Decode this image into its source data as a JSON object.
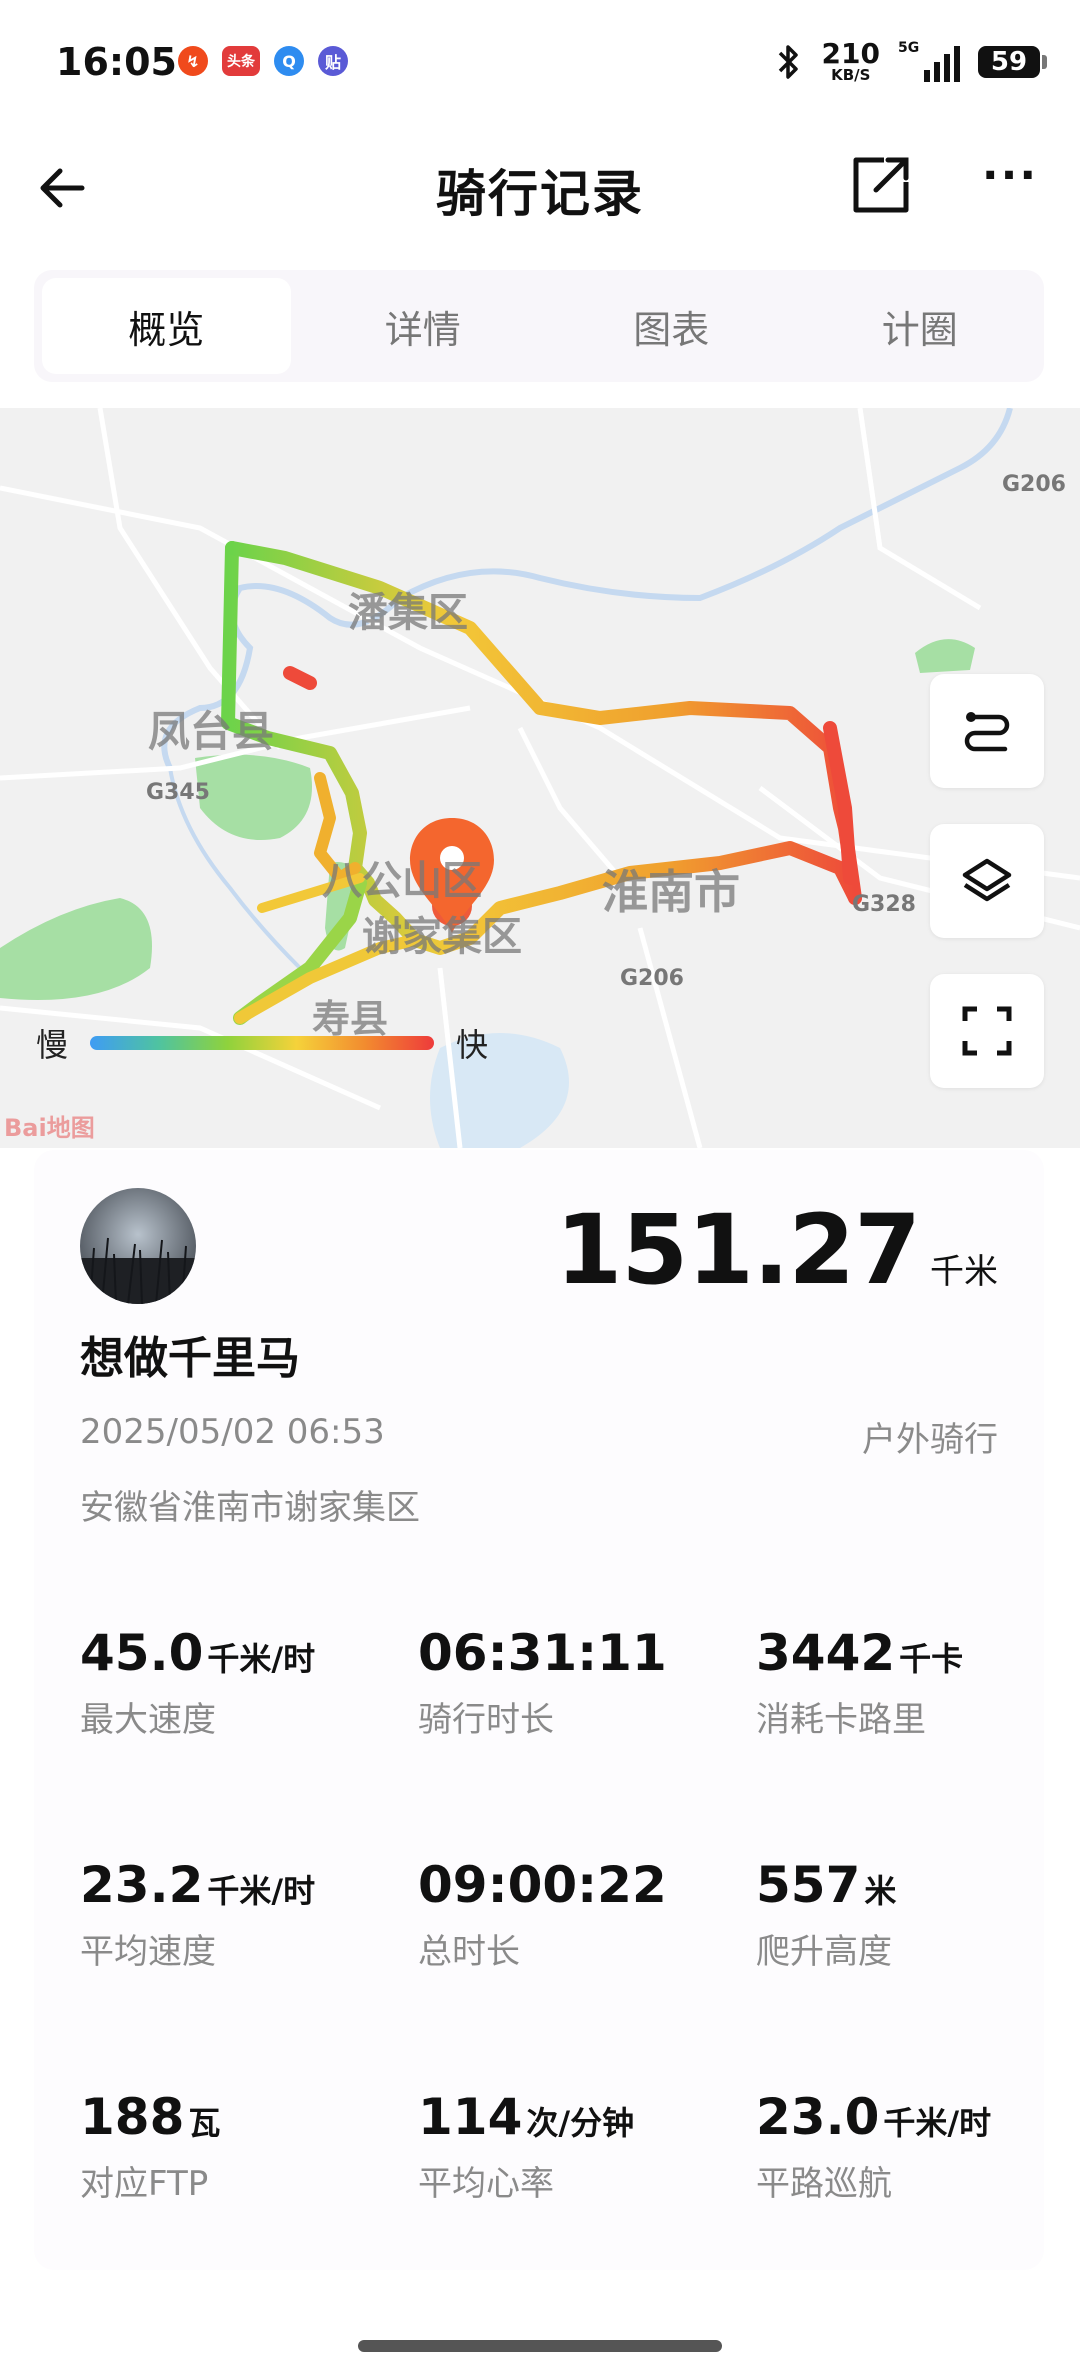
{
  "status_bar": {
    "time": "16:05",
    "app_icons": [
      {
        "name": "news-app-icon",
        "glyph": "↯",
        "color": "#f04a1c"
      },
      {
        "name": "toutiao-app-icon",
        "glyph": "头条",
        "color": "#e23b3b"
      },
      {
        "name": "browser-app-icon",
        "glyph": "Q",
        "color": "#2e8cf0"
      },
      {
        "name": "tieba-app-icon",
        "glyph": "贴",
        "color": "#5a5ad6"
      }
    ],
    "net_speed_value": "210",
    "net_speed_unit": "KB/S",
    "network": "5G",
    "battery": "59"
  },
  "header": {
    "title": "骑行记录"
  },
  "tabs": [
    {
      "label": "概览",
      "active": true
    },
    {
      "label": "详情",
      "active": false
    },
    {
      "label": "图表",
      "active": false
    },
    {
      "label": "计圈",
      "active": false
    }
  ],
  "map": {
    "place_labels": [
      "潘集区",
      "凤台县",
      "八公山区",
      "谢家集区",
      "淮南市",
      "寿县"
    ],
    "road_labels": [
      "G206",
      "G345",
      "G206",
      "G328"
    ],
    "legend": {
      "slow": "慢",
      "fast": "快"
    },
    "provider": "Bai地图"
  },
  "summary": {
    "username": "想做千里马",
    "distance_value": "151.27",
    "distance_unit": "千米",
    "datetime": "2025/05/02 06:53",
    "sport_type": "户外骑行",
    "location": "安徽省淮南市谢家集区"
  },
  "stats": [
    {
      "value": "45.0",
      "unit": "千米/时",
      "label": "最大速度"
    },
    {
      "value": "06:31:11",
      "unit": "",
      "label": "骑行时长"
    },
    {
      "value": "3442",
      "unit": "千卡",
      "label": "消耗卡路里"
    },
    {
      "value": "23.2",
      "unit": "千米/时",
      "label": "平均速度"
    },
    {
      "value": "09:00:22",
      "unit": "",
      "label": "总时长"
    },
    {
      "value": "557",
      "unit": "米",
      "label": "爬升高度"
    },
    {
      "value": "188",
      "unit": "瓦",
      "label": "对应FTP"
    },
    {
      "value": "114",
      "unit": "次/分钟",
      "label": "平均心率"
    },
    {
      "value": "23.0",
      "unit": "千米/时",
      "label": "平路巡航"
    }
  ]
}
